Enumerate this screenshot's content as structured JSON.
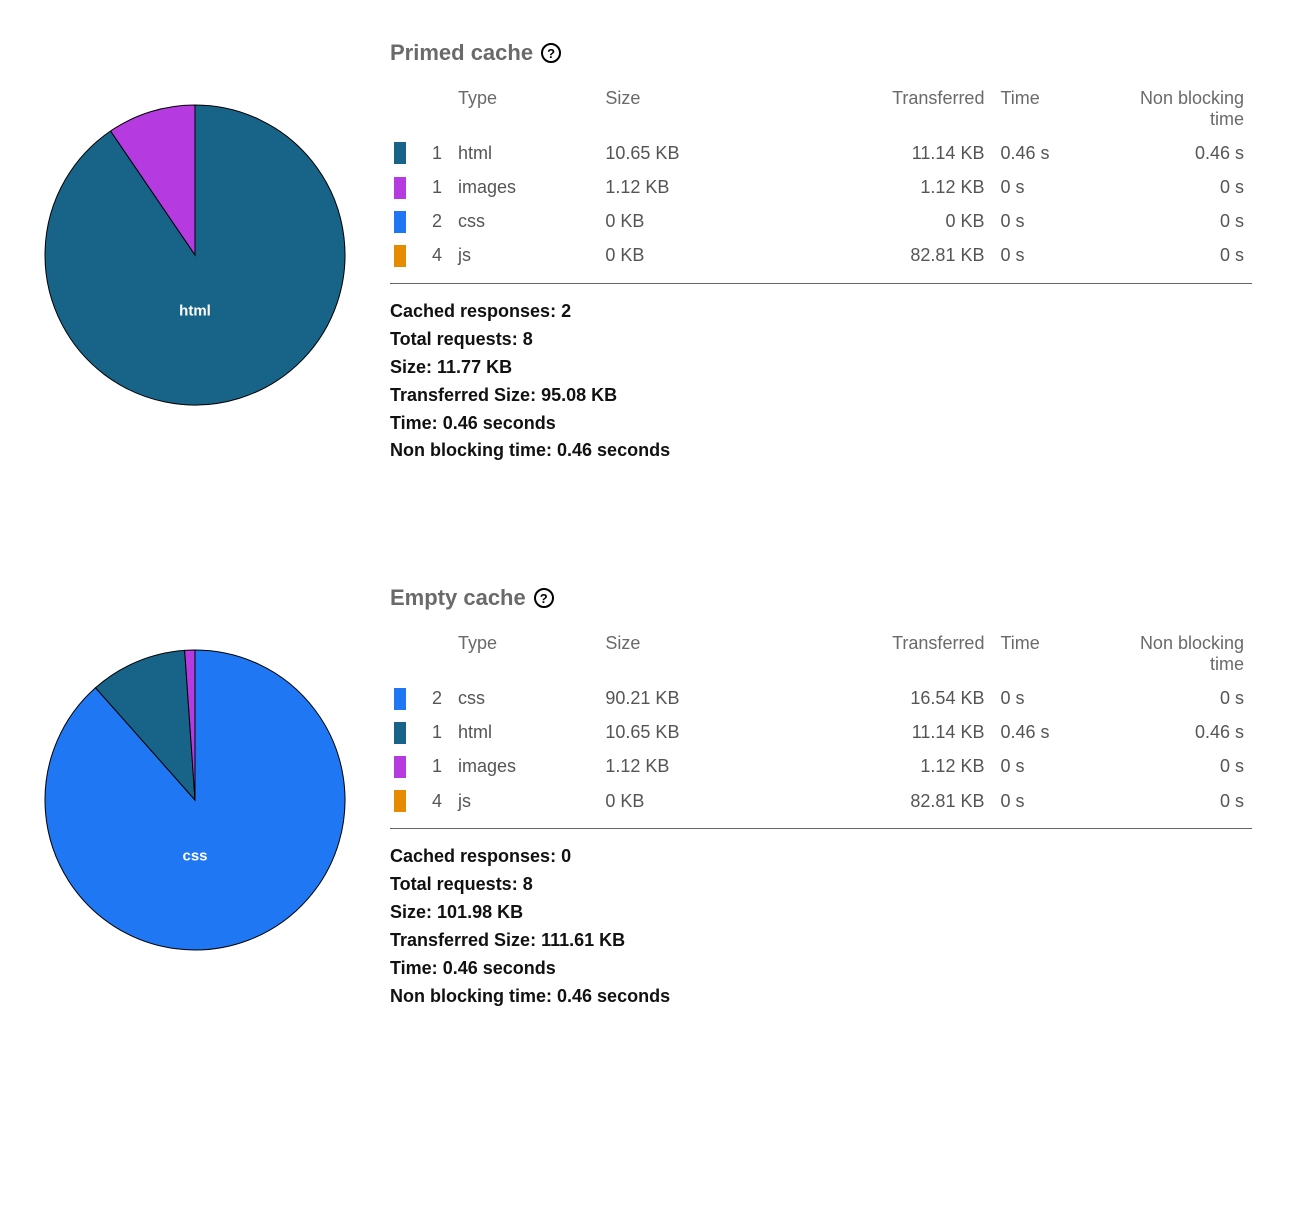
{
  "colors": {
    "html": "#186488",
    "images": "#b53be0",
    "css": "#1f77f3",
    "js": "#e68a00"
  },
  "headers": {
    "type": "Type",
    "size": "Size",
    "transferred": "Transferred",
    "time": "Time",
    "nonblocking": "Non blocking time"
  },
  "summary_labels": {
    "cached": "Cached responses:",
    "total": "Total requests:",
    "size": "Size:",
    "transferred": "Transferred Size:",
    "time": "Time:",
    "nonblocking": "Non blocking time:"
  },
  "primed": {
    "title": "Primed cache",
    "pie_label": "html",
    "rows": [
      {
        "color_key": "html",
        "count": "1",
        "type": "html",
        "size": "10.65 KB",
        "transferred": "11.14 KB",
        "time": "0.46 s",
        "nonblocking": "0.46 s"
      },
      {
        "color_key": "images",
        "count": "1",
        "type": "images",
        "size": "1.12 KB",
        "transferred": "1.12 KB",
        "time": "0 s",
        "nonblocking": "0 s"
      },
      {
        "color_key": "css",
        "count": "2",
        "type": "css",
        "size": "0 KB",
        "transferred": "0 KB",
        "time": "0 s",
        "nonblocking": "0 s"
      },
      {
        "color_key": "js",
        "count": "4",
        "type": "js",
        "size": "0 KB",
        "transferred": "82.81 KB",
        "time": "0 s",
        "nonblocking": "0 s"
      }
    ],
    "summary": {
      "cached": "2",
      "total": "8",
      "size": "11.77 KB",
      "transferred": "95.08 KB",
      "time": "0.46 seconds",
      "nonblocking": "0.46 seconds"
    }
  },
  "empty": {
    "title": "Empty cache",
    "pie_label": "css",
    "rows": [
      {
        "color_key": "css",
        "count": "2",
        "type": "css",
        "size": "90.21 KB",
        "transferred": "16.54 KB",
        "time": "0 s",
        "nonblocking": "0 s"
      },
      {
        "color_key": "html",
        "count": "1",
        "type": "html",
        "size": "10.65 KB",
        "transferred": "11.14 KB",
        "time": "0.46 s",
        "nonblocking": "0.46 s"
      },
      {
        "color_key": "images",
        "count": "1",
        "type": "images",
        "size": "1.12 KB",
        "transferred": "1.12 KB",
        "time": "0 s",
        "nonblocking": "0 s"
      },
      {
        "color_key": "js",
        "count": "4",
        "type": "js",
        "size": "0 KB",
        "transferred": "82.81 KB",
        "time": "0 s",
        "nonblocking": "0 s"
      }
    ],
    "summary": {
      "cached": "0",
      "total": "8",
      "size": "101.98 KB",
      "transferred": "111.61 KB",
      "time": "0.46 seconds",
      "nonblocking": "0.46 seconds"
    }
  },
  "chart_data": [
    {
      "type": "pie",
      "title": "Primed cache",
      "series_name": "Size (KB)",
      "categories": [
        "html",
        "images",
        "css",
        "js"
      ],
      "values": [
        10.65,
        1.12,
        0,
        0
      ],
      "annotations": [
        "html"
      ]
    },
    {
      "type": "pie",
      "title": "Empty cache",
      "series_name": "Size (KB)",
      "categories": [
        "css",
        "html",
        "images",
        "js"
      ],
      "values": [
        90.21,
        10.65,
        1.12,
        0
      ],
      "annotations": [
        "css"
      ]
    }
  ]
}
